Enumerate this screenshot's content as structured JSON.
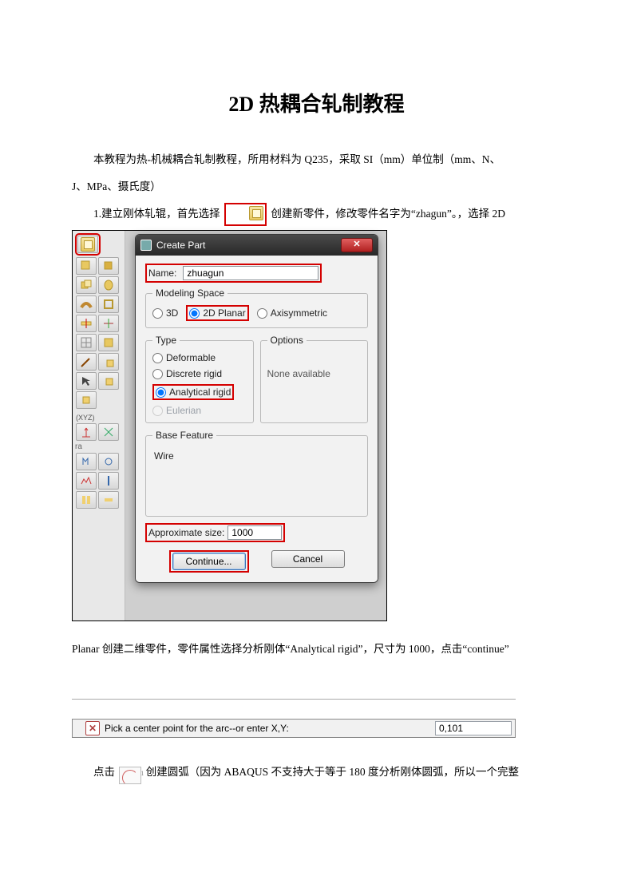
{
  "title": "2D 热耦合轧制教程",
  "para1a": "本教程为热-机械耦合轧制教程，所用材料为 Q235，采取 SI（mm）单位制（mm、N、",
  "para1b": "J、MPa、摄氏度）",
  "para2a": "1.建立刚体轧辊，首先选择",
  "para2b": "创建新零件，修改零件名字为“zhagun”。，选择 2D",
  "dialog": {
    "title": "Create Part",
    "name_label": "Name:",
    "name_value": "zhuagun",
    "modeling_space": "Modeling Space",
    "ms": {
      "3d": "3D",
      "planar": "2D Planar",
      "axi": "Axisymmetric"
    },
    "type_legend": "Type",
    "options_legend": "Options",
    "type": {
      "deformable": "Deformable",
      "discrete": "Discrete rigid",
      "analytical": "Analytical rigid",
      "eulerian": "Eulerian"
    },
    "none_available": "None available",
    "base_feature": "Base Feature",
    "wire": "Wire",
    "approx_label": "Approximate size:",
    "approx_value": "1000",
    "continue": "Continue...",
    "cancel": "Cancel"
  },
  "para3": "Planar 创建二维零件，零件属性选择分析刚体“Analytical rigid”，尺寸为 1000，点击“continue”",
  "prompt": {
    "msg": "Pick a center point for the arc--or enter X,Y:",
    "coord": "0,101"
  },
  "para4a": "点击",
  "para4b": "创建圆弧（因为 ABAQUS 不支持大于等于 180 度分析刚体圆弧，所以一个完整"
}
